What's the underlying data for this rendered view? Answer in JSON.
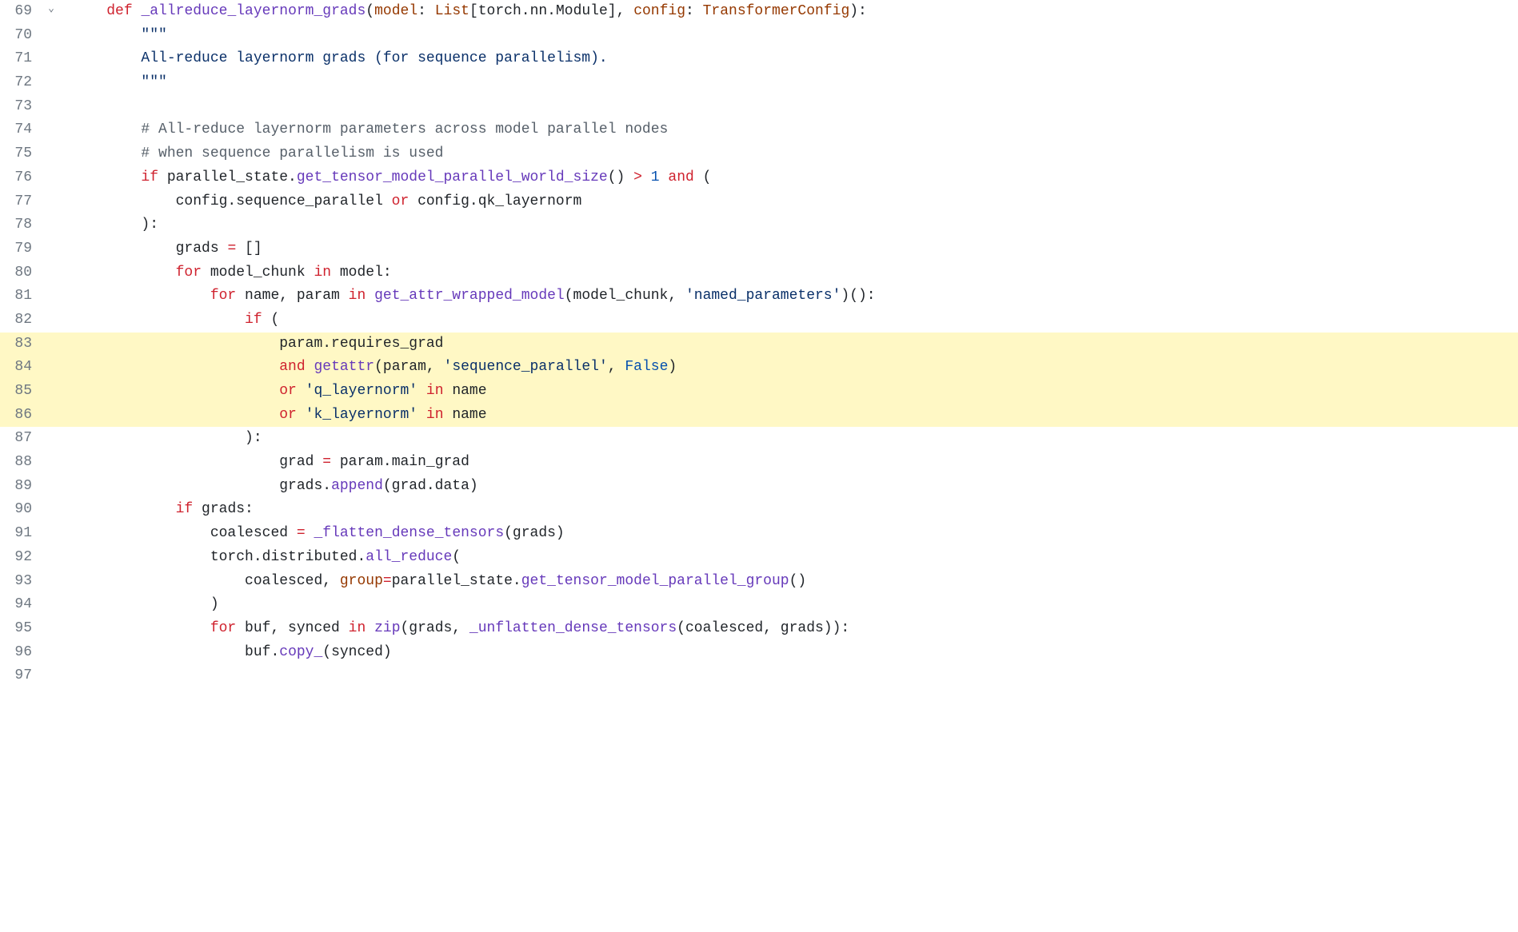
{
  "lines": [
    {
      "num": "69",
      "fold": true,
      "hl": false,
      "indent": "    ",
      "tokens": [
        {
          "c": "k-def",
          "t": "def "
        },
        {
          "c": "fn-name",
          "t": "_allreduce_layernorm_grads"
        },
        {
          "c": "plain",
          "t": "("
        },
        {
          "c": "kwarg",
          "t": "model"
        },
        {
          "c": "plain",
          "t": ": "
        },
        {
          "c": "type",
          "t": "List"
        },
        {
          "c": "plain",
          "t": "[torch.nn.Module], "
        },
        {
          "c": "kwarg",
          "t": "config"
        },
        {
          "c": "plain",
          "t": ": "
        },
        {
          "c": "type",
          "t": "TransformerConfig"
        },
        {
          "c": "plain",
          "t": "):"
        }
      ]
    },
    {
      "num": "70",
      "fold": false,
      "hl": false,
      "indent": "        ",
      "tokens": [
        {
          "c": "doc",
          "t": "\"\"\""
        }
      ]
    },
    {
      "num": "71",
      "fold": false,
      "hl": false,
      "indent": "        ",
      "tokens": [
        {
          "c": "doc",
          "t": "All-reduce layernorm grads (for sequence parallelism)."
        }
      ]
    },
    {
      "num": "72",
      "fold": false,
      "hl": false,
      "indent": "        ",
      "tokens": [
        {
          "c": "doc",
          "t": "\"\"\""
        }
      ]
    },
    {
      "num": "73",
      "fold": false,
      "hl": false,
      "indent": "",
      "tokens": []
    },
    {
      "num": "74",
      "fold": false,
      "hl": false,
      "indent": "        ",
      "tokens": [
        {
          "c": "cmt",
          "t": "# All-reduce layernorm parameters across model parallel nodes"
        }
      ]
    },
    {
      "num": "75",
      "fold": false,
      "hl": false,
      "indent": "        ",
      "tokens": [
        {
          "c": "cmt",
          "t": "# when sequence parallelism is used"
        }
      ]
    },
    {
      "num": "76",
      "fold": false,
      "hl": false,
      "indent": "        ",
      "tokens": [
        {
          "c": "k-ctrl",
          "t": "if"
        },
        {
          "c": "plain",
          "t": " parallel_state."
        },
        {
          "c": "fn-call",
          "t": "get_tensor_model_parallel_world_size"
        },
        {
          "c": "plain",
          "t": "() "
        },
        {
          "c": "k-op",
          "t": ">"
        },
        {
          "c": "plain",
          "t": " "
        },
        {
          "c": "num",
          "t": "1"
        },
        {
          "c": "plain",
          "t": " "
        },
        {
          "c": "k-op",
          "t": "and"
        },
        {
          "c": "plain",
          "t": " ("
        }
      ]
    },
    {
      "num": "77",
      "fold": false,
      "hl": false,
      "indent": "            ",
      "tokens": [
        {
          "c": "plain",
          "t": "config.sequence_parallel "
        },
        {
          "c": "k-op",
          "t": "or"
        },
        {
          "c": "plain",
          "t": " config.qk_layernorm"
        }
      ]
    },
    {
      "num": "78",
      "fold": false,
      "hl": false,
      "indent": "        ",
      "tokens": [
        {
          "c": "plain",
          "t": "):"
        }
      ]
    },
    {
      "num": "79",
      "fold": false,
      "hl": false,
      "indent": "            ",
      "tokens": [
        {
          "c": "plain",
          "t": "grads "
        },
        {
          "c": "k-op",
          "t": "="
        },
        {
          "c": "plain",
          "t": " []"
        }
      ]
    },
    {
      "num": "80",
      "fold": false,
      "hl": false,
      "indent": "            ",
      "tokens": [
        {
          "c": "k-ctrl",
          "t": "for"
        },
        {
          "c": "plain",
          "t": " model_chunk "
        },
        {
          "c": "k-ctrl",
          "t": "in"
        },
        {
          "c": "plain",
          "t": " model:"
        }
      ]
    },
    {
      "num": "81",
      "fold": false,
      "hl": false,
      "indent": "                ",
      "tokens": [
        {
          "c": "k-ctrl",
          "t": "for"
        },
        {
          "c": "plain",
          "t": " name, param "
        },
        {
          "c": "k-ctrl",
          "t": "in"
        },
        {
          "c": "plain",
          "t": " "
        },
        {
          "c": "fn-call",
          "t": "get_attr_wrapped_model"
        },
        {
          "c": "plain",
          "t": "(model_chunk, "
        },
        {
          "c": "str",
          "t": "'named_parameters'"
        },
        {
          "c": "plain",
          "t": ")():"
        }
      ]
    },
    {
      "num": "82",
      "fold": false,
      "hl": false,
      "indent": "                    ",
      "tokens": [
        {
          "c": "k-ctrl",
          "t": "if"
        },
        {
          "c": "plain",
          "t": " ("
        }
      ]
    },
    {
      "num": "83",
      "fold": false,
      "hl": true,
      "indent": "                        ",
      "tokens": [
        {
          "c": "plain",
          "t": "param.requires_grad"
        }
      ]
    },
    {
      "num": "84",
      "fold": false,
      "hl": true,
      "indent": "                        ",
      "tokens": [
        {
          "c": "k-op",
          "t": "and"
        },
        {
          "c": "plain",
          "t": " "
        },
        {
          "c": "fn-call",
          "t": "getattr"
        },
        {
          "c": "plain",
          "t": "(param, "
        },
        {
          "c": "str",
          "t": "'sequence_parallel'"
        },
        {
          "c": "plain",
          "t": ", "
        },
        {
          "c": "const",
          "t": "False"
        },
        {
          "c": "plain",
          "t": ")"
        }
      ]
    },
    {
      "num": "85",
      "fold": false,
      "hl": true,
      "indent": "                        ",
      "tokens": [
        {
          "c": "k-op",
          "t": "or"
        },
        {
          "c": "plain",
          "t": " "
        },
        {
          "c": "str",
          "t": "'q_layernorm'"
        },
        {
          "c": "plain",
          "t": " "
        },
        {
          "c": "k-ctrl",
          "t": "in"
        },
        {
          "c": "plain",
          "t": " name"
        }
      ]
    },
    {
      "num": "86",
      "fold": false,
      "hl": true,
      "indent": "                        ",
      "tokens": [
        {
          "c": "k-op",
          "t": "or"
        },
        {
          "c": "plain",
          "t": " "
        },
        {
          "c": "str",
          "t": "'k_layernorm'"
        },
        {
          "c": "plain",
          "t": " "
        },
        {
          "c": "k-ctrl",
          "t": "in"
        },
        {
          "c": "plain",
          "t": " name"
        }
      ]
    },
    {
      "num": "87",
      "fold": false,
      "hl": false,
      "indent": "                    ",
      "tokens": [
        {
          "c": "plain",
          "t": "):"
        }
      ]
    },
    {
      "num": "88",
      "fold": false,
      "hl": false,
      "indent": "                        ",
      "tokens": [
        {
          "c": "plain",
          "t": "grad "
        },
        {
          "c": "k-op",
          "t": "="
        },
        {
          "c": "plain",
          "t": " param.main_grad"
        }
      ]
    },
    {
      "num": "89",
      "fold": false,
      "hl": false,
      "indent": "                        ",
      "tokens": [
        {
          "c": "plain",
          "t": "grads."
        },
        {
          "c": "fn-call",
          "t": "append"
        },
        {
          "c": "plain",
          "t": "(grad.data)"
        }
      ]
    },
    {
      "num": "90",
      "fold": false,
      "hl": false,
      "indent": "            ",
      "tokens": [
        {
          "c": "k-ctrl",
          "t": "if"
        },
        {
          "c": "plain",
          "t": " grads:"
        }
      ]
    },
    {
      "num": "91",
      "fold": false,
      "hl": false,
      "indent": "                ",
      "tokens": [
        {
          "c": "plain",
          "t": "coalesced "
        },
        {
          "c": "k-op",
          "t": "="
        },
        {
          "c": "plain",
          "t": " "
        },
        {
          "c": "fn-call",
          "t": "_flatten_dense_tensors"
        },
        {
          "c": "plain",
          "t": "(grads)"
        }
      ]
    },
    {
      "num": "92",
      "fold": false,
      "hl": false,
      "indent": "                ",
      "tokens": [
        {
          "c": "plain",
          "t": "torch.distributed."
        },
        {
          "c": "fn-call",
          "t": "all_reduce"
        },
        {
          "c": "plain",
          "t": "("
        }
      ]
    },
    {
      "num": "93",
      "fold": false,
      "hl": false,
      "indent": "                    ",
      "tokens": [
        {
          "c": "plain",
          "t": "coalesced, "
        },
        {
          "c": "kwarg",
          "t": "group"
        },
        {
          "c": "k-op",
          "t": "="
        },
        {
          "c": "plain",
          "t": "parallel_state."
        },
        {
          "c": "fn-call",
          "t": "get_tensor_model_parallel_group"
        },
        {
          "c": "plain",
          "t": "()"
        }
      ]
    },
    {
      "num": "94",
      "fold": false,
      "hl": false,
      "indent": "                ",
      "tokens": [
        {
          "c": "plain",
          "t": ")"
        }
      ]
    },
    {
      "num": "95",
      "fold": false,
      "hl": false,
      "indent": "                ",
      "tokens": [
        {
          "c": "k-ctrl",
          "t": "for"
        },
        {
          "c": "plain",
          "t": " buf, synced "
        },
        {
          "c": "k-ctrl",
          "t": "in"
        },
        {
          "c": "plain",
          "t": " "
        },
        {
          "c": "fn-call",
          "t": "zip"
        },
        {
          "c": "plain",
          "t": "(grads, "
        },
        {
          "c": "fn-call",
          "t": "_unflatten_dense_tensors"
        },
        {
          "c": "plain",
          "t": "(coalesced, grads)):"
        }
      ]
    },
    {
      "num": "96",
      "fold": false,
      "hl": false,
      "indent": "                    ",
      "tokens": [
        {
          "c": "plain",
          "t": "buf."
        },
        {
          "c": "fn-call",
          "t": "copy_"
        },
        {
          "c": "plain",
          "t": "(synced)"
        }
      ]
    },
    {
      "num": "97",
      "fold": false,
      "hl": false,
      "indent": "",
      "tokens": []
    }
  ],
  "fold_glyph": "⌄"
}
